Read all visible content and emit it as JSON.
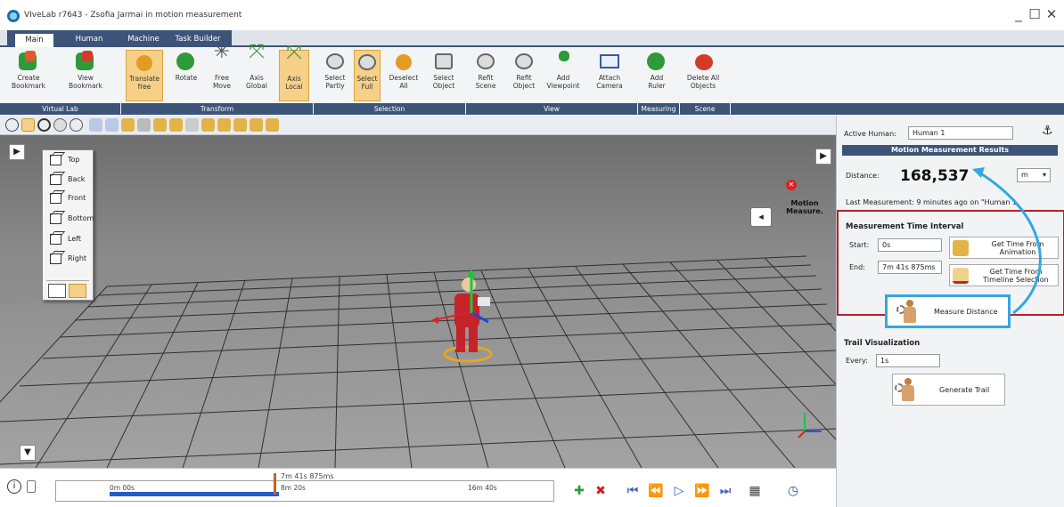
{
  "window": {
    "title": "VIveLab r7643 - Zsofia Jarmai in motion measurement",
    "minimize": "_",
    "maximize": "☐",
    "close": "✕"
  },
  "tabs": [
    {
      "label": "Main",
      "active": true
    },
    {
      "label": "Human",
      "active": false
    },
    {
      "label": "Machine",
      "active": false
    },
    {
      "label": "Task Builder",
      "active": false
    }
  ],
  "ribbon": {
    "create_bookmark": "Create\nBookmark",
    "view_bookmark": "View\nBookmark",
    "translate": "Translate\nfree",
    "rotate": "Rotate",
    "free_move": "Free\nMove",
    "axis_global": "Axis\nGlobal",
    "axis_local": "Axis\nLocal",
    "select_partly": "Select\nPartly",
    "select_full": "Select\nFull",
    "deselect_all": "Deselect\nAll",
    "select_object": "Select\nObject",
    "refit_scene": "Refit\nScene",
    "refit_object": "Refit\nObject",
    "add_viewpoint": "Add\nViewpoint",
    "attach_camera": "Attach\nCamera",
    "add_ruler": "Add\nRuler",
    "delete_all_objects": "Delete All\nObjects",
    "groups": {
      "virtual_lab": "Virtual Lab",
      "transform": "Transform",
      "selection": "Selection",
      "view": "View",
      "measuring": "Measuring",
      "scene": "Scene"
    }
  },
  "view_menu": {
    "items": [
      "Top",
      "Back",
      "Front",
      "Bottom",
      "Left",
      "Right"
    ]
  },
  "viewport": {
    "motion_measure_label": "Motion\nMeasure."
  },
  "timeline": {
    "start": "0m 00s",
    "mid": "8m 20s",
    "end": "16m 40s",
    "marker": "7m 41s 875ms",
    "fill_fraction": 0.46
  },
  "panel": {
    "active_human_label": "Active Human:",
    "active_human_value": "Human 1",
    "header": "Motion Measurement Results",
    "distance_label": "Distance:",
    "distance_value": "168,537",
    "unit": "m",
    "last_measurement": "Last Measurement:  9 minutes ago on \"Human 1",
    "interval_title": "Measurement Time Interval",
    "start_label": "Start:",
    "start_value": "0s",
    "end_label": "End:",
    "end_value": "7m 41s 875ms",
    "get_from_animation": "Get Time From\nAnimation",
    "get_from_timeline": "Get Time From\nTimeline Selection",
    "measure_distance": "Measure Distance",
    "trail_title": "Trail Visualization",
    "every_label": "Every:",
    "every_value": "1s",
    "generate_trail": "Generate Trail"
  },
  "colors": {
    "accent": "#3c5478",
    "highlight": "#f6d087",
    "callout_red": "#b3232a",
    "callout_blue": "#35a7e0"
  }
}
